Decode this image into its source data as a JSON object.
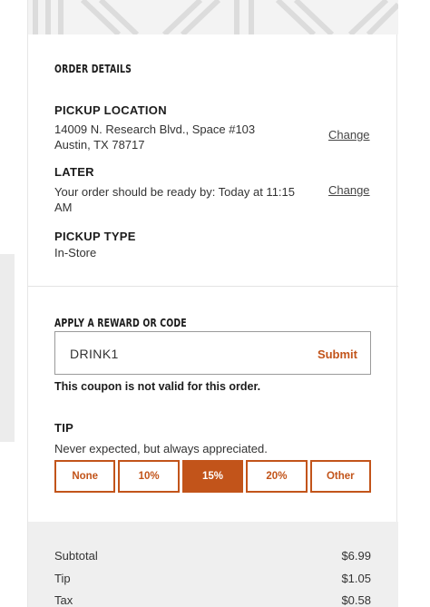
{
  "order_details": {
    "title": "ORDER DETAILS",
    "pickup_location": {
      "label": "PICKUP LOCATION",
      "address_line1": "14009 N. Research Blvd., Space #103",
      "address_line2": "Austin, TX 78717",
      "change_label": "Change"
    },
    "later": {
      "label": "LATER",
      "message_line1": "Your order should be ready by: Today at 11:15",
      "message_line2": "AM",
      "change_label": "Change"
    },
    "pickup_type": {
      "label": "PICKUP TYPE",
      "value": "In-Store"
    }
  },
  "reward": {
    "title": "APPLY A REWARD OR CODE",
    "code_value": "DRINK1",
    "submit_label": "Submit",
    "error": "This coupon is not valid for this order."
  },
  "tip": {
    "label": "TIP",
    "subtitle": "Never expected, but always appreciated.",
    "options": [
      "None",
      "10%",
      "15%",
      "20%",
      "Other"
    ],
    "selected": "15%"
  },
  "summary": {
    "rows": [
      {
        "label": "Subtotal",
        "value": "$6.99"
      },
      {
        "label": "Tip",
        "value": "$1.05"
      },
      {
        "label": "Tax",
        "value": "$0.58"
      }
    ]
  },
  "colors": {
    "accent": "#c2541a",
    "summary_bg": "#efefef"
  }
}
